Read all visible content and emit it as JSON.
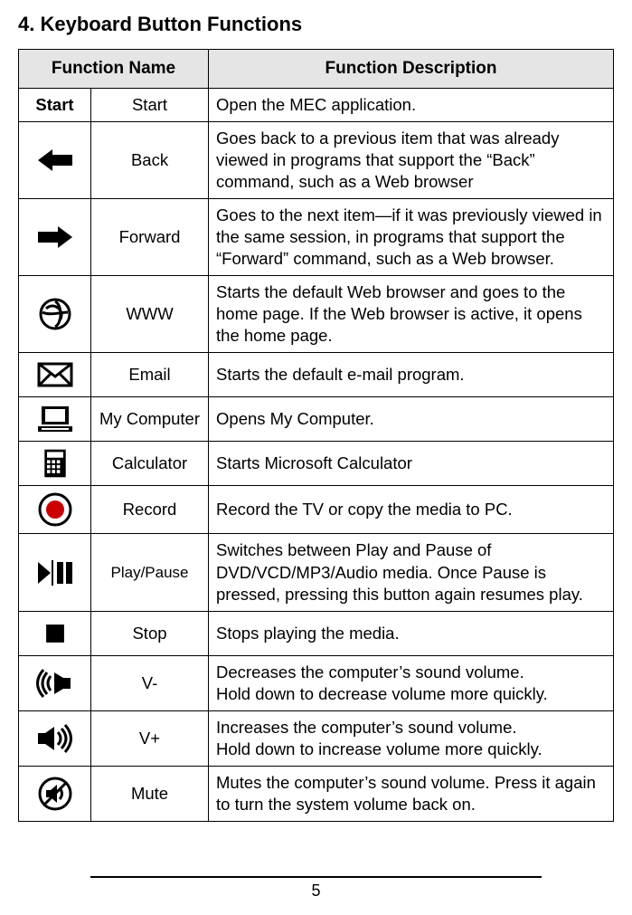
{
  "heading": "4. Keyboard Button Functions",
  "table": {
    "headers": {
      "name": "Function Name",
      "desc": "Function Description"
    },
    "rows": [
      {
        "icon": "start-text",
        "name": "Start",
        "desc": "Open the MEC application."
      },
      {
        "icon": "back-icon",
        "name": "Back",
        "desc": "Goes back to a previous item that was already viewed in programs that support the “Back” command, such as a Web browser"
      },
      {
        "icon": "forward-icon",
        "name": "Forward",
        "desc": "Goes to the next item—if it was previously viewed in the same session, in programs that support the “Forward” command, such as a Web browser."
      },
      {
        "icon": "www-icon",
        "name": "WWW",
        "desc": "Starts the default Web browser and goes to the home page. If the Web browser is active, it opens the home page."
      },
      {
        "icon": "email-icon",
        "name": "Email",
        "desc": "Starts the default e-mail program."
      },
      {
        "icon": "computer-icon",
        "name": "My Computer",
        "desc": "Opens My Computer."
      },
      {
        "icon": "calc-icon",
        "name": "Calculator",
        "desc": "Starts Microsoft Calculator"
      },
      {
        "icon": "record-icon",
        "name": "Record",
        "desc": "Record the TV or copy the media to PC."
      },
      {
        "icon": "play-icon",
        "name": "Play/Pause",
        "desc": "Switches between Play and Pause of DVD/VCD/MP3/Audio media. Once Pause is pressed, pressing this button again resumes play."
      },
      {
        "icon": "stop-icon",
        "name": "Stop",
        "desc": "Stops playing the media."
      },
      {
        "icon": "voldown-icon",
        "name": "V-",
        "desc": "Decreases the computer’s sound volume.\nHold down to decrease volume more quickly."
      },
      {
        "icon": "volup-icon",
        "name": "V+",
        "desc": "Increases the computer’s sound volume.\nHold down to increase volume more quickly."
      },
      {
        "icon": "mute-icon",
        "name": "Mute",
        "desc": "Mutes the computer’s sound volume. Press it again to turn the system volume back on."
      }
    ]
  },
  "start_button_label": "Start",
  "page_number": "5"
}
